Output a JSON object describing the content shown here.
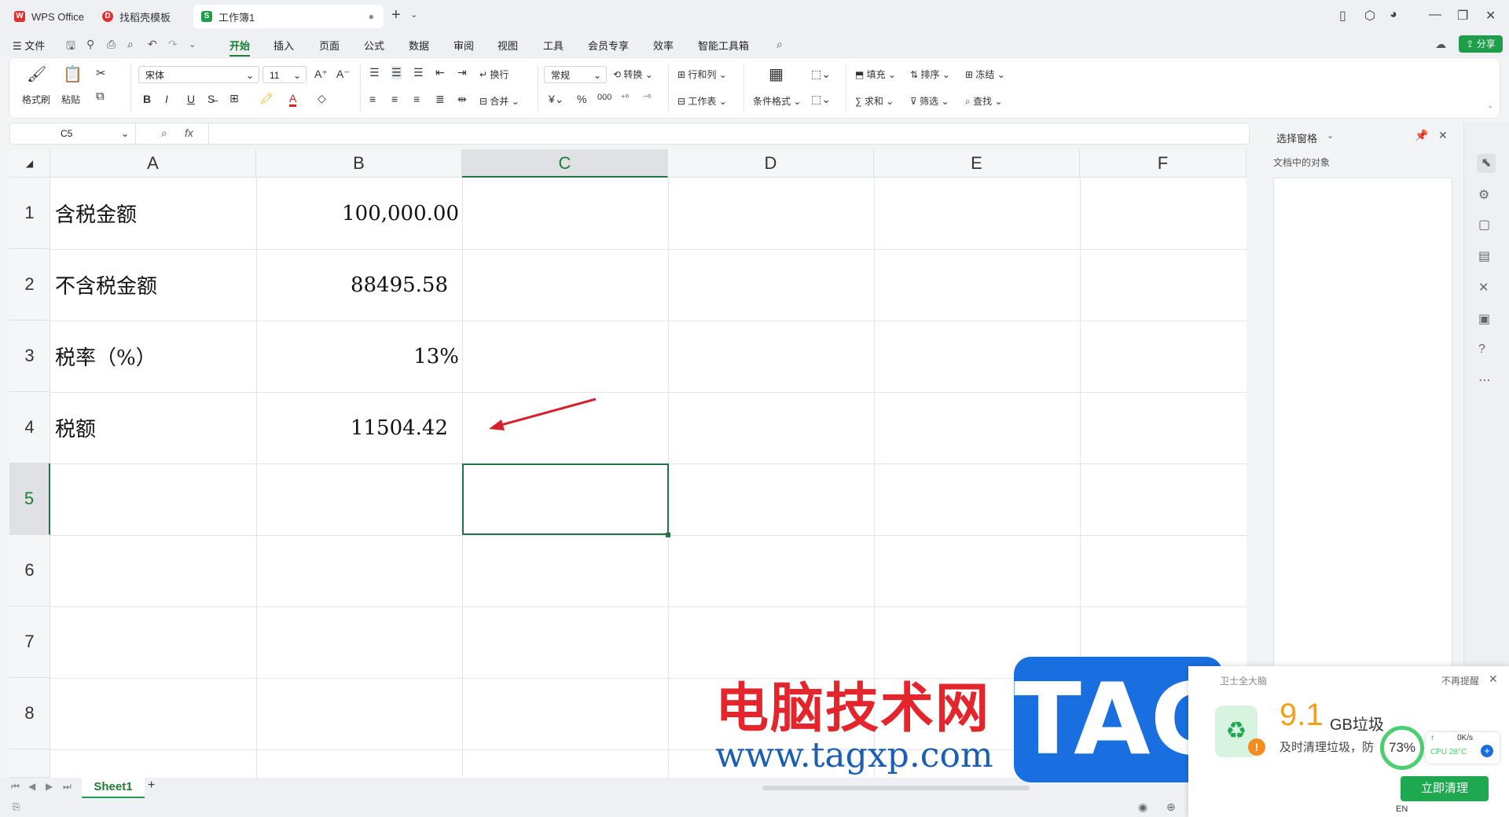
{
  "tabs": [
    {
      "label": "WPS Office"
    },
    {
      "label": "找稻壳模板"
    },
    {
      "label": "工作簿1"
    }
  ],
  "menu": {
    "file": "文件",
    "items": [
      "开始",
      "插入",
      "页面",
      "公式",
      "数据",
      "审阅",
      "视图",
      "工具",
      "会员专享",
      "效率",
      "智能工具箱"
    ],
    "active": "开始",
    "share": "分享"
  },
  "ribbon": {
    "format_painter": "格式刷",
    "paste": "粘贴",
    "font_name": "宋体",
    "font_size": "11",
    "wrap": "换行",
    "merge": "合并",
    "number_format": "常规",
    "convert": "转换",
    "row_col": "行和列",
    "worksheet": "工作表",
    "cond_format": "条件格式",
    "fill": "填充",
    "sort": "排序",
    "freeze": "冻结",
    "sum": "求和",
    "filter": "筛选",
    "find": "查找",
    "bold": "B",
    "italic": "I",
    "underline": "U"
  },
  "formula_bar": {
    "name_box": "C5",
    "fx": "fx",
    "value": ""
  },
  "grid": {
    "columns": [
      "A",
      "B",
      "C",
      "D",
      "E",
      "F"
    ],
    "rows": [
      "1",
      "2",
      "3",
      "4",
      "5",
      "6",
      "7",
      "8"
    ],
    "selected": "C5",
    "cells": {
      "A1": "含税金额",
      "B1": "100,000.00",
      "A2": "不含税金额",
      "B2": "88495.58",
      "A3": "税率（%）",
      "B3": "13%",
      "A4": "税额",
      "B4": "11504.42"
    }
  },
  "panel": {
    "title": "选择窗格",
    "subtitle": "文档中的对象"
  },
  "sheets": {
    "active": "Sheet1",
    "add": "+"
  },
  "watermark": {
    "cn": "电脑技术网",
    "url": "www.tagxp.com",
    "logo": "TAG"
  },
  "popup": {
    "brand": "卫士全大脑",
    "dismiss": "不再提醒",
    "size_value": "9.1",
    "size_unit": "GB垃圾",
    "desc": "及时清理垃圾，防",
    "percent": "73%",
    "speed": "0K/s",
    "cpu": "CPU 28°C",
    "cta": "立即清理",
    "lang": "EN"
  },
  "colors": {
    "accent": "#1e7d34",
    "selected_border": "#217346",
    "arrow": "#d6202a"
  }
}
